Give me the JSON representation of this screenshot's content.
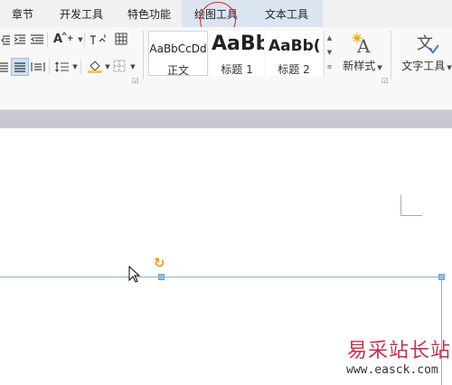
{
  "tabs": [
    {
      "label": "章节"
    },
    {
      "label": "开发工具"
    },
    {
      "label": "特色功能"
    },
    {
      "label": "绘图工具"
    },
    {
      "label": "文本工具"
    }
  ],
  "ribbon": {
    "styles": [
      {
        "preview": "AaBbCcDd",
        "name": "正文"
      },
      {
        "preview": "AaBb",
        "name": "标题 1"
      },
      {
        "preview": "AaBb(",
        "name": "标题 2"
      }
    ],
    "new_style_label": "新样式",
    "text_tool_label": "文字工具"
  },
  "watermark": {
    "text": "易采站长站",
    "url": "www.easck.com"
  }
}
